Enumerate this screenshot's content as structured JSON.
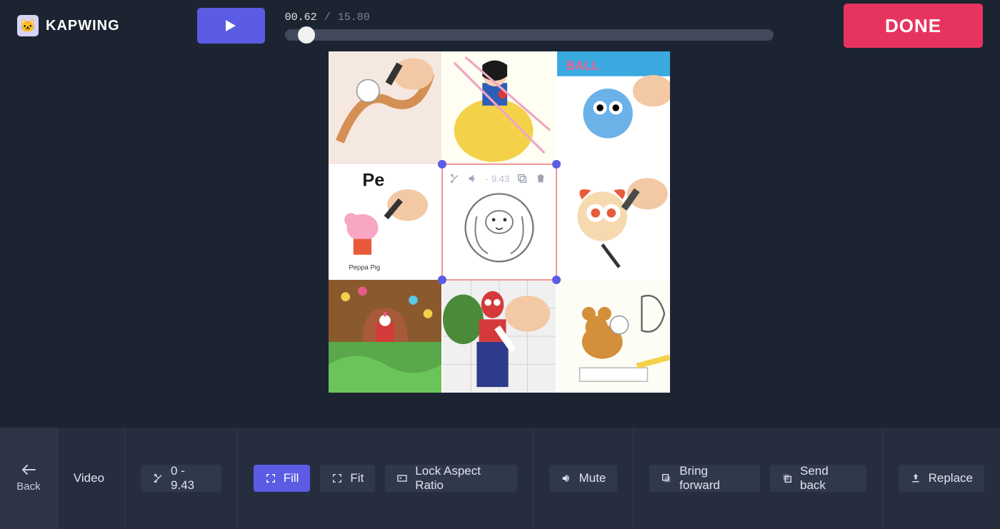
{
  "header": {
    "brand": "KAPWING",
    "time_current": "00.62",
    "time_separator": "/",
    "time_duration": "15.80",
    "done_label": "DONE"
  },
  "selected_cell": {
    "range_text": "- 9.43"
  },
  "toolbar": {
    "back_label": "Back",
    "section_label": "Video",
    "trim_range": "0 - 9.43",
    "fill_label": "Fill",
    "fit_label": "Fit",
    "lock_label": "Lock Aspect Ratio",
    "mute_label": "Mute",
    "bring_forward_label": "Bring forward",
    "send_back_label": "Send back",
    "replace_label": "Replace"
  }
}
